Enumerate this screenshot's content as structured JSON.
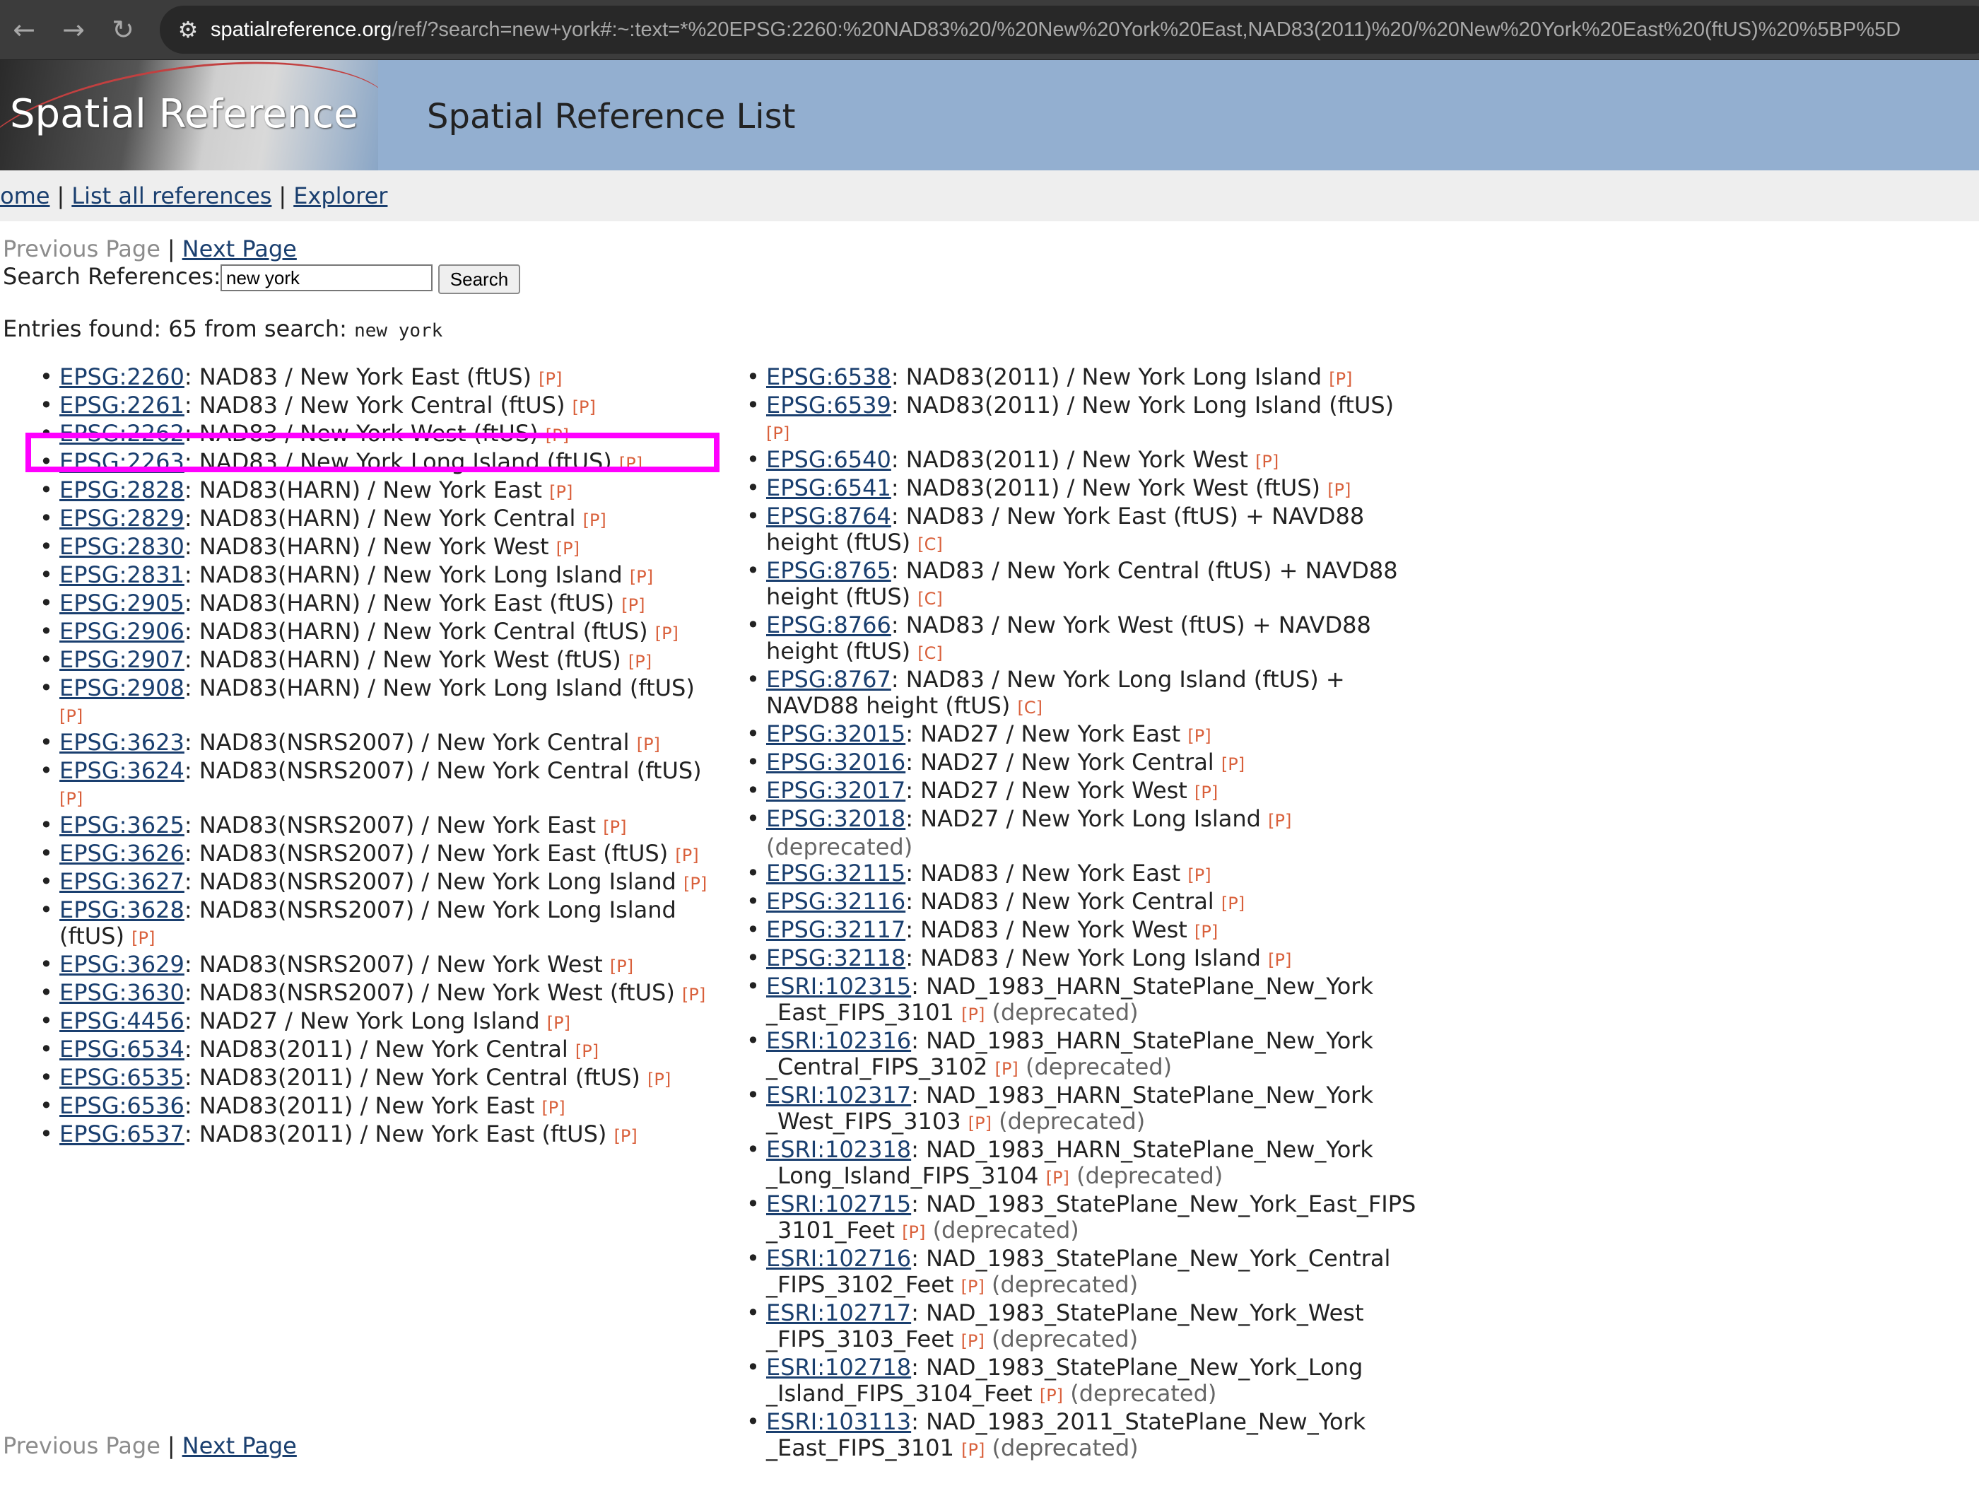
{
  "browser": {
    "back_icon": "arrow-left-icon",
    "forward_icon": "arrow-right-icon",
    "reload_icon": "reload-icon",
    "url_host": "spatialreference.org",
    "url_rest": "/ref/?search=new+york#:~:text=*%20EPSG:2260:%20NAD83%20/%20New%20York%20East,NAD83(2011)%20/%20New%20York%20East%20(ftUS)%20%5BP%5D"
  },
  "header": {
    "logo_text": "Spatial Reference",
    "title": "Spatial Reference List"
  },
  "nav": {
    "home": "Home",
    "list_all": "List all references",
    "explorer": "Explorer",
    "sep": "|"
  },
  "pager": {
    "previous": "Previous Page",
    "next": "Next Page",
    "sep": "|"
  },
  "search": {
    "label": "Search References:",
    "value": "new york",
    "button": "Search"
  },
  "results": {
    "prefix": "Entries found: 65 from search:",
    "query": "new york"
  },
  "columns": [
    [
      {
        "code": "EPSG:2260",
        "name": ": NAD83 / New York East (ftUS)",
        "tag": "[P]",
        "note": ""
      },
      {
        "code": "EPSG:2261",
        "name": ": NAD83 / New York Central (ftUS)",
        "tag": "[P]",
        "note": ""
      },
      {
        "code": "EPSG:2262",
        "name": ": NAD83 / New York West (ftUS)",
        "tag": "[P]",
        "note": ""
      },
      {
        "code": "EPSG:2263",
        "name": ": NAD83 / New York Long Island (ftUS)",
        "tag": "[P]",
        "note": ""
      },
      {
        "code": "EPSG:2828",
        "name": ": NAD83(HARN) / New York East",
        "tag": "[P]",
        "note": ""
      },
      {
        "code": "EPSG:2829",
        "name": ": NAD83(HARN) / New York Central",
        "tag": "[P]",
        "note": ""
      },
      {
        "code": "EPSG:2830",
        "name": ": NAD83(HARN) / New York West",
        "tag": "[P]",
        "note": ""
      },
      {
        "code": "EPSG:2831",
        "name": ": NAD83(HARN) / New York Long Island",
        "tag": "[P]",
        "note": ""
      },
      {
        "code": "EPSG:2905",
        "name": ": NAD83(HARN) / New York East (ftUS)",
        "tag": "[P]",
        "note": ""
      },
      {
        "code": "EPSG:2906",
        "name": ": NAD83(HARN) / New York Central (ftUS)",
        "tag": "[P]",
        "note": ""
      },
      {
        "code": "EPSG:2907",
        "name": ": NAD83(HARN) / New York West (ftUS)",
        "tag": "[P]",
        "note": ""
      },
      {
        "code": "EPSG:2908",
        "name": ": NAD83(HARN) / New York Long Island (ftUS)",
        "tag": "[P]",
        "note": ""
      },
      {
        "code": "EPSG:3623",
        "name": ": NAD83(NSRS2007) / New York Central",
        "tag": "[P]",
        "note": ""
      },
      {
        "code": "EPSG:3624",
        "name": ": NAD83(NSRS2007) / New York Central (ftUS)",
        "tag": "[P]",
        "note": ""
      },
      {
        "code": "EPSG:3625",
        "name": ": NAD83(NSRS2007) / New York East",
        "tag": "[P]",
        "note": ""
      },
      {
        "code": "EPSG:3626",
        "name": ": NAD83(NSRS2007) / New York East (ftUS)",
        "tag": "[P]",
        "note": ""
      },
      {
        "code": "EPSG:3627",
        "name": ": NAD83(NSRS2007) / New York Long Island",
        "tag": "[P]",
        "note": ""
      },
      {
        "code": "EPSG:3628",
        "name": ": NAD83(NSRS2007) / New York Long Island (ftUS)",
        "tag": "[P]",
        "note": ""
      },
      {
        "code": "EPSG:3629",
        "name": ": NAD83(NSRS2007) / New York West",
        "tag": "[P]",
        "note": ""
      },
      {
        "code": "EPSG:3630",
        "name": ": NAD83(NSRS2007) / New York West (ftUS)",
        "tag": "[P]",
        "note": ""
      },
      {
        "code": "EPSG:4456",
        "name": ": NAD27 / New York Long Island",
        "tag": "[P]",
        "note": ""
      },
      {
        "code": "EPSG:6534",
        "name": ": NAD83(2011) / New York Central",
        "tag": "[P]",
        "note": ""
      },
      {
        "code": "EPSG:6535",
        "name": ": NAD83(2011) / New York Central (ftUS)",
        "tag": "[P]",
        "note": ""
      },
      {
        "code": "EPSG:6536",
        "name": ": NAD83(2011) / New York East",
        "tag": "[P]",
        "note": ""
      },
      {
        "code": "EPSG:6537",
        "name": ": NAD83(2011) / New York East (ftUS)",
        "tag": "[P]",
        "note": ""
      }
    ],
    [
      {
        "code": "EPSG:6538",
        "name": ": NAD83(2011) / New York Long Island",
        "tag": "[P]",
        "note": ""
      },
      {
        "code": "EPSG:6539",
        "name": ": NAD83(2011) / New York Long Island (ftUS)",
        "tag": "[P]",
        "note": ""
      },
      {
        "code": "EPSG:6540",
        "name": ": NAD83(2011) / New York West",
        "tag": "[P]",
        "note": ""
      },
      {
        "code": "EPSG:6541",
        "name": ": NAD83(2011) / New York West (ftUS)",
        "tag": "[P]",
        "note": ""
      },
      {
        "code": "EPSG:8764",
        "name": ": NAD83 / New York East (ftUS) + NAVD88 height (ftUS)",
        "tag": "[C]",
        "note": ""
      },
      {
        "code": "EPSG:8765",
        "name": ": NAD83 / New York Central (ftUS) + NAVD88 height (ftUS)",
        "tag": "[C]",
        "note": ""
      },
      {
        "code": "EPSG:8766",
        "name": ": NAD83 / New York West (ftUS) + NAVD88 height (ftUS)",
        "tag": "[C]",
        "note": ""
      },
      {
        "code": "EPSG:8767",
        "name": ": NAD83 / New York Long Island (ftUS) + NAVD88 height (ftUS)",
        "tag": "[C]",
        "note": ""
      },
      {
        "code": "EPSG:32015",
        "name": ": NAD27 / New York East",
        "tag": "[P]",
        "note": ""
      },
      {
        "code": "EPSG:32016",
        "name": ": NAD27 / New York Central",
        "tag": "[P]",
        "note": ""
      },
      {
        "code": "EPSG:32017",
        "name": ": NAD27 / New York West",
        "tag": "[P]",
        "note": ""
      },
      {
        "code": "EPSG:32018",
        "name": ": NAD27 / New York Long Island",
        "tag": "[P]",
        "note": "(deprecated)"
      },
      {
        "code": "EPSG:32115",
        "name": ": NAD83 / New York East",
        "tag": "[P]",
        "note": ""
      },
      {
        "code": "EPSG:32116",
        "name": ": NAD83 / New York Central",
        "tag": "[P]",
        "note": ""
      },
      {
        "code": "EPSG:32117",
        "name": ": NAD83 / New York West",
        "tag": "[P]",
        "note": ""
      },
      {
        "code": "EPSG:32118",
        "name": ": NAD83 / New York Long Island",
        "tag": "[P]",
        "note": ""
      },
      {
        "code": "ESRI:102315",
        "name": ": NAD_1983_HARN_StatePlane_New_York _East_FIPS_3101",
        "tag": "[P]",
        "note": "(deprecated)"
      },
      {
        "code": "ESRI:102316",
        "name": ": NAD_1983_HARN_StatePlane_New_York _Central_FIPS_3102",
        "tag": "[P]",
        "note": "(deprecated)"
      },
      {
        "code": "ESRI:102317",
        "name": ": NAD_1983_HARN_StatePlane_New_York _West_FIPS_3103",
        "tag": "[P]",
        "note": "(deprecated)"
      },
      {
        "code": "ESRI:102318",
        "name": ": NAD_1983_HARN_StatePlane_New_York _Long_Island_FIPS_3104",
        "tag": "[P]",
        "note": "(deprecated)"
      },
      {
        "code": "ESRI:102715",
        "name": ": NAD_1983_StatePlane_New_York_East_FIPS _3101_Feet",
        "tag": "[P]",
        "note": "(deprecated)"
      },
      {
        "code": "ESRI:102716",
        "name": ": NAD_1983_StatePlane_New_York_Central _FIPS_3102_Feet",
        "tag": "[P]",
        "note": "(deprecated)"
      },
      {
        "code": "ESRI:102717",
        "name": ": NAD_1983_StatePlane_New_York_West _FIPS_3103_Feet",
        "tag": "[P]",
        "note": "(deprecated)"
      },
      {
        "code": "ESRI:102718",
        "name": ": NAD_1983_StatePlane_New_York_Long _Island_FIPS_3104_Feet",
        "tag": "[P]",
        "note": "(deprecated)"
      },
      {
        "code": "ESRI:103113",
        "name": ": NAD_1983_2011_StatePlane_New_York _East_FIPS_3101",
        "tag": "[P]",
        "note": "(deprecated)"
      }
    ]
  ],
  "colors": {
    "link": "#1a3f6f",
    "tag": "#d9603b",
    "header_bg": "#93afd0",
    "highlight": "#ff00ff"
  }
}
